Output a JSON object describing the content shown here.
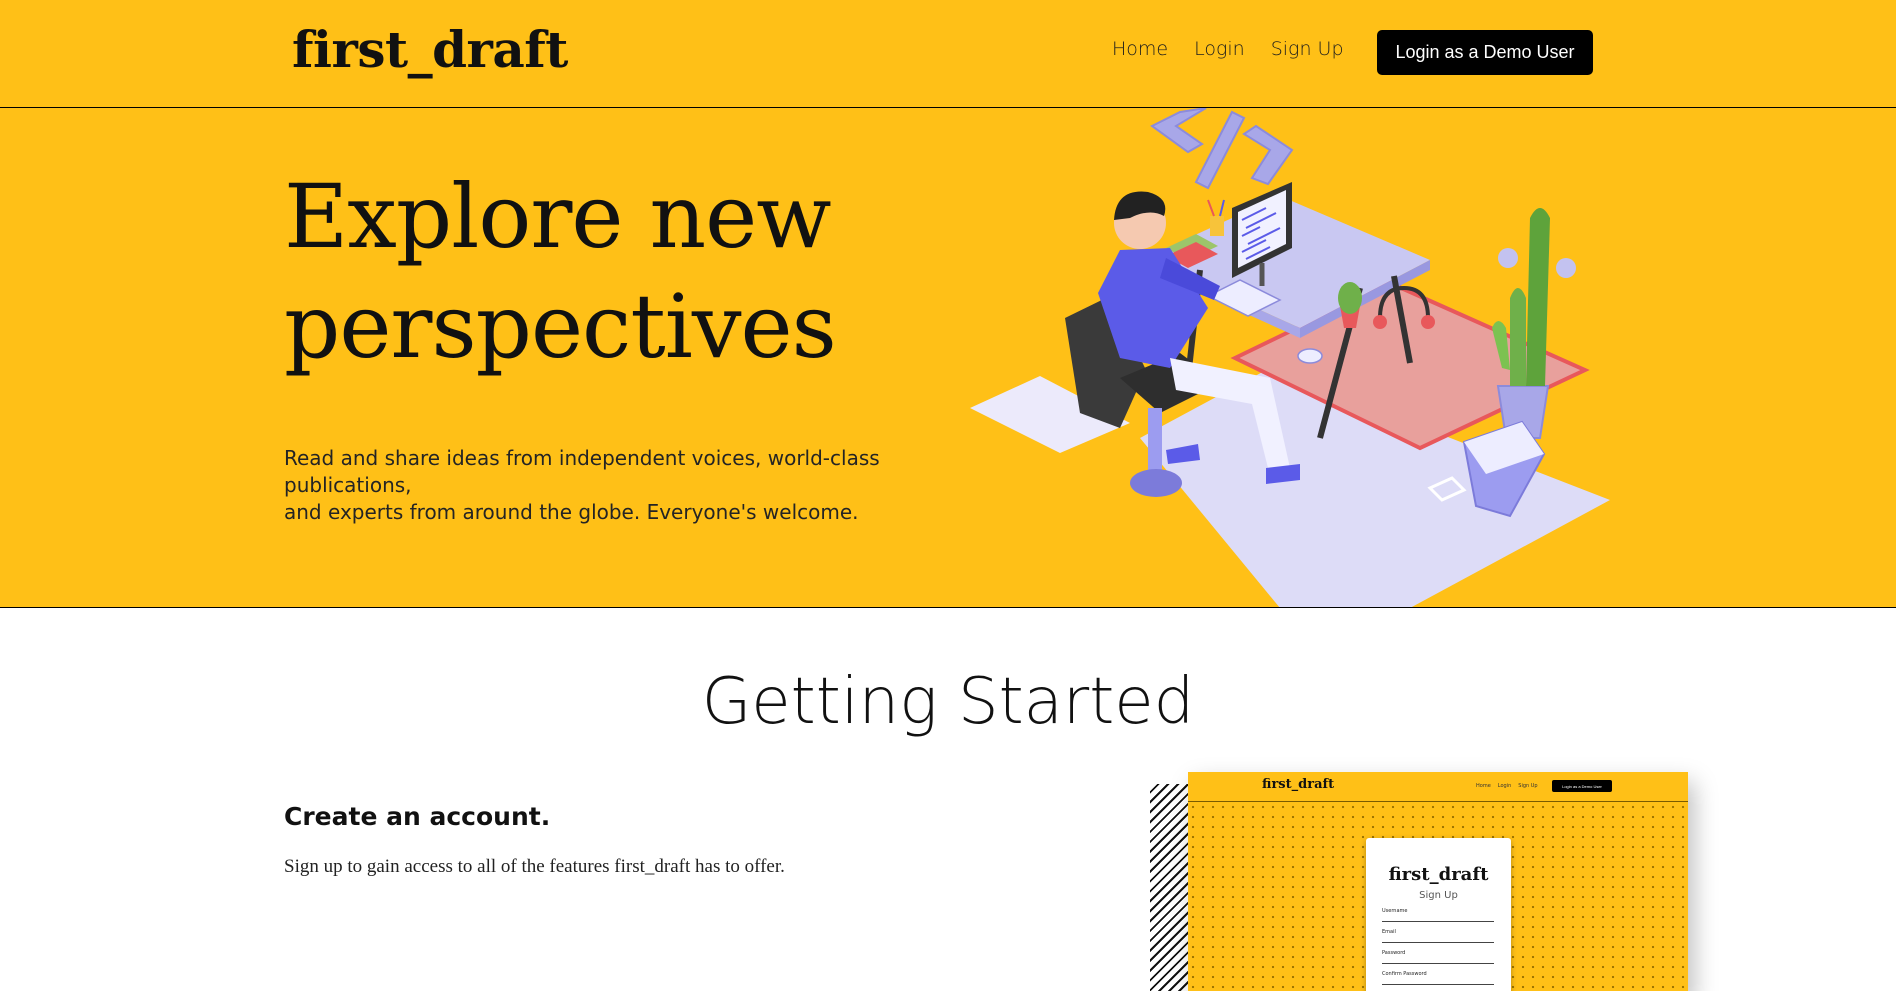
{
  "nav": {
    "brand": "first_draft",
    "links": [
      "Home",
      "Login",
      "Sign Up"
    ],
    "demo_button": "Login as a Demo User"
  },
  "hero": {
    "title_line1": "Explore new",
    "title_line2": "perspectives",
    "subtitle_line1": "Read and share ideas from independent voices, world-class publications,",
    "subtitle_line2": "and experts from around the globe. Everyone's welcome."
  },
  "getting_started": {
    "title": "Getting Started",
    "step_title": "Create an account.",
    "step_description": "Sign up to gain access to all of the features first_draft has to offer."
  },
  "preview": {
    "brand": "first_draft",
    "links": [
      "Home",
      "Login",
      "Sign Up"
    ],
    "demo_button": "Login as a Demo User",
    "card_title": "first_draft",
    "card_subtitle": "Sign Up",
    "fields": [
      "Username",
      "Email",
      "Password",
      "Confirm Password"
    ]
  },
  "colors": {
    "accent": "#FFC017",
    "button": "#000000",
    "illustration_lavender": "#9C9CF0",
    "illustration_blue": "#5B5BE8",
    "illustration_red": "#E8585B"
  }
}
